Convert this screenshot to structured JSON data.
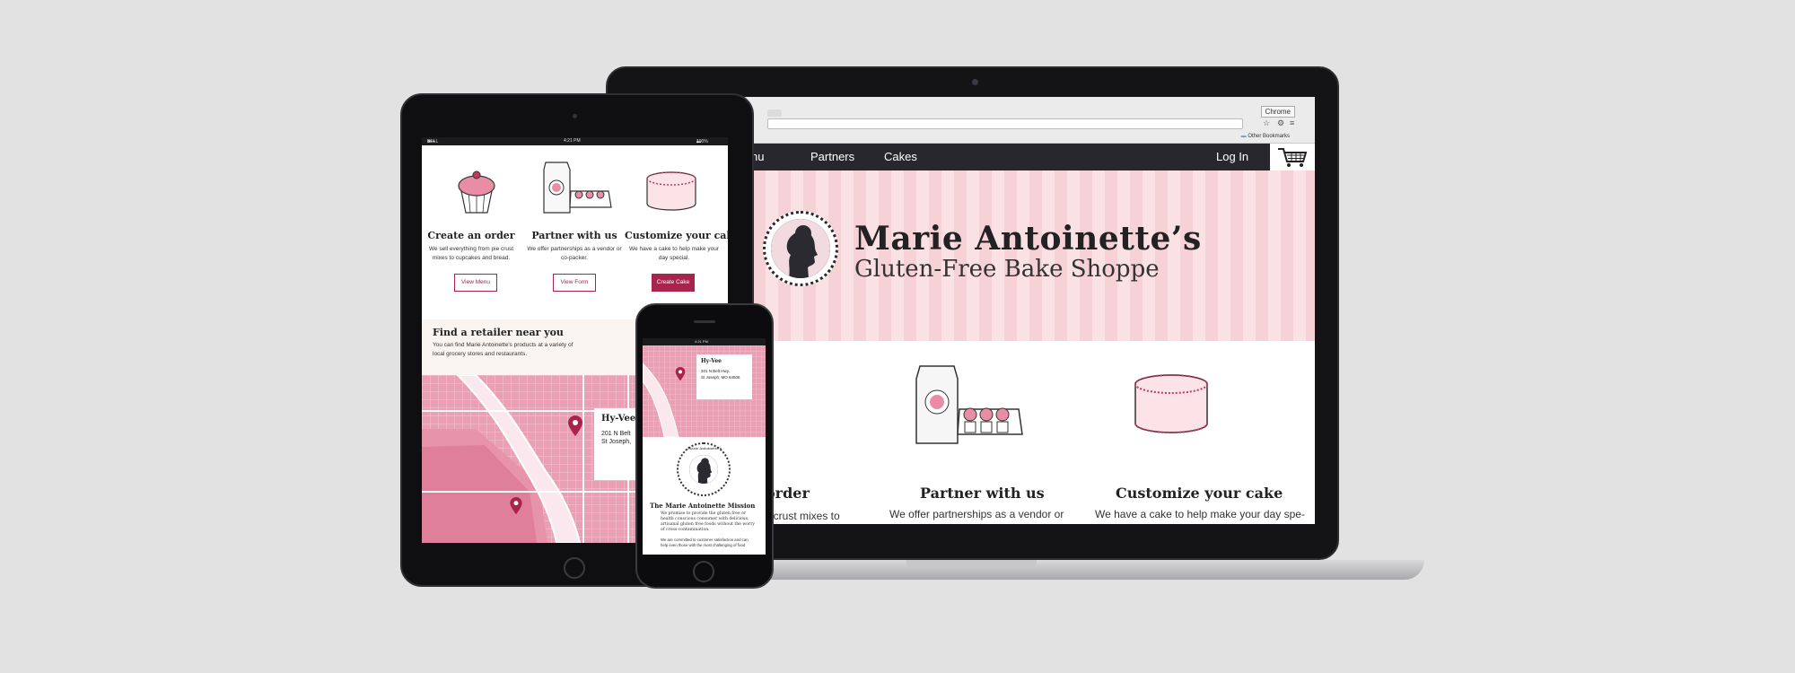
{
  "browser": {
    "window_button": "Chrome",
    "bookmark_folder": "Other Bookmarks"
  },
  "site_nav": {
    "items": [
      "Menu",
      "Partners",
      "Cakes"
    ],
    "login": "Log In"
  },
  "hero": {
    "title": "Marie Antoinette’s",
    "subtitle": "Gluten-Free Bake Shoppe"
  },
  "desktop_features": [
    {
      "title": "order",
      "text": "ie crust mixes to"
    },
    {
      "title": "Partner with us",
      "text": "We offer partnerships as a vendor or"
    },
    {
      "title": "Customize your cake",
      "text": "We have a cake to help make your day spe-"
    }
  ],
  "tablet": {
    "status": {
      "carrier": "BELL",
      "time": "4:21 PM",
      "battery": "100%"
    },
    "features": [
      {
        "title": "Create an order",
        "text": "We sell everything from pie crust mixes to cupcakes and bread.",
        "button": "View Menu"
      },
      {
        "title": "Partner with us",
        "text": "We offer partnerships as a vendor or co-packer.",
        "button": "View Form"
      },
      {
        "title": "Customize your cake",
        "text": "We have a cake to help make your day special.",
        "button": "Create Cake"
      }
    ],
    "retailer": {
      "title": "Find a retailer near you",
      "text": "You can find Marie Antoinette's products at a variety of local grocery stores and restaurants."
    },
    "map_card": {
      "name": "Hy-Vee",
      "line1": "201 N Belt",
      "line2": "St Joseph,"
    }
  },
  "phone": {
    "status": {
      "time": "4:21 PM"
    },
    "map_card": {
      "name": "Hy-Vee",
      "line1": "201 N Belt Hwy,",
      "line2": "St Joseph, MO 64506"
    },
    "seal_text": "Marie Antoinette's",
    "mission_title": "The Marie Antoinette Mission",
    "mission_text": "We promise to provide the gluten free or health conscious consumer with delicious, artisanal gluten free foods without the worry of cross-contamination.",
    "mission_text2": "We are committed to customer satisfaction and can help even those with the most challenging of food"
  },
  "colors": {
    "brand": "#a8244d",
    "nav_bg": "#28272d",
    "hero_stripe_light": "#fae1e3",
    "hero_stripe_dark": "#f6d2d6",
    "map_pink": "#eaa0b4"
  }
}
